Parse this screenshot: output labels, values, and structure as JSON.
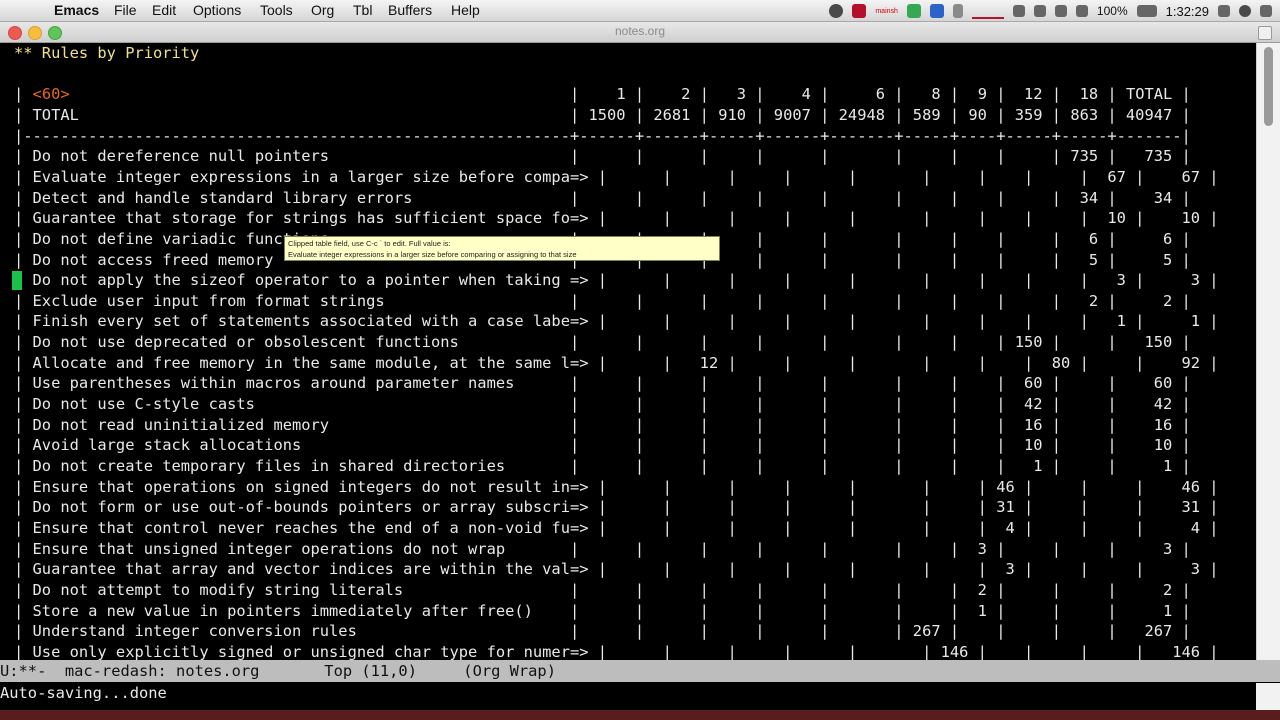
{
  "menubar": {
    "apple": "",
    "app": "Emacs",
    "items": [
      "File",
      "Edit",
      "Options",
      "Tools",
      "Org",
      "Tbl",
      "Buffers",
      "Help"
    ],
    "status": {
      "user_label": "mainsh",
      "battery": "100%",
      "clock": "1:32:29"
    }
  },
  "window": {
    "title": "notes.org"
  },
  "buffer": {
    "lines": [
      {
        "cls": "heading",
        "text": "** Rules by Priority"
      },
      {
        "cls": "blank",
        "text": ""
      },
      {
        "cls": "cookie",
        "pre": "| ",
        "hl": "<60>",
        "post": "                                                      |    1 |    2 |   3 |    4 |     6 |   8 |  9 |  12 |  18 | TOTAL |"
      },
      {
        "cls": "tbl",
        "text": "| TOTAL                                                     | 1500 | 2681 | 910 | 9007 | 24948 | 589 | 90 | 359 | 863 | 40947 |"
      },
      {
        "cls": "sep",
        "text": "|-----------------------------------------------------------+------+------+-----+------+-------+-----+----+-----+-----+-------|"
      },
      {
        "cls": "tbl",
        "text": "| Do not dereference null pointers                          |      |      |     |      |       |     |    |     | 735 |   735 |"
      },
      {
        "cls": "tbl",
        "text": "| Evaluate integer expressions in a larger size before compa=> |      |      |     |      |       |     |    |     |  67 |    67 |"
      },
      {
        "cls": "tbl",
        "text": "| Detect and handle standard library errors                 |      |      |     |      |       |     |    |     |  34 |    34 |"
      },
      {
        "cls": "tbl",
        "text": "| Guarantee that storage for strings has sufficient space fo=> |      |      |     |      |       |     |    |     |  10 |    10 |"
      },
      {
        "cls": "tbl",
        "text": "| Do not define variadic functions                          |      |      |     |      |       |     |    |     |   6 |     6 |"
      },
      {
        "cls": "tbl",
        "text": "| Do not access freed memory                                |      |      |     |      |       |     |    |     |   5 |     5 |"
      },
      {
        "cls": "tbl",
        "text": "| Do not apply the sizeof operator to a pointer when taking => |      |      |     |      |       |     |    |     |   3 |     3 |"
      },
      {
        "cls": "tbl",
        "text": "| Exclude user input from format strings                    |      |      |     |      |       |     |    |     |   2 |     2 |"
      },
      {
        "cls": "tbl",
        "text": "| Finish every set of statements associated with a case labe=> |      |      |     |      |       |     |    |     |   1 |     1 |"
      },
      {
        "cls": "tbl",
        "text": "| Do not use deprecated or obsolescent functions            |      |      |     |      |       |     |    | 150 |     |   150 |"
      },
      {
        "cls": "tbl",
        "text": "| Allocate and free memory in the same module, at the same l=> |      |   12 |     |      |       |     |    |  80 |     |    92 |"
      },
      {
        "cls": "tbl",
        "text": "| Use parentheses within macros around parameter names      |      |      |     |      |       |     |    |  60 |     |    60 |"
      },
      {
        "cls": "tbl",
        "text": "| Do not use C-style casts                                  |      |      |     |      |       |     |    |  42 |     |    42 |"
      },
      {
        "cls": "tbl",
        "text": "| Do not read uninitialized memory                          |      |      |     |      |       |     |    |  16 |     |    16 |"
      },
      {
        "cls": "tbl",
        "text": "| Avoid large stack allocations                             |      |      |     |      |       |     |    |  10 |     |    10 |"
      },
      {
        "cls": "tbl",
        "text": "| Do not create temporary files in shared directories       |      |      |     |      |       |     |    |   1 |     |     1 |"
      },
      {
        "cls": "tbl",
        "text": "| Ensure that operations on signed integers do not result in=> |      |      |     |      |       |     | 46 |     |     |    46 |"
      },
      {
        "cls": "tbl",
        "text": "| Do not form or use out-of-bounds pointers or array subscri=> |      |      |     |      |       |     | 31 |     |     |    31 |"
      },
      {
        "cls": "tbl",
        "text": "| Ensure that control never reaches the end of a non-void fu=> |      |      |     |      |       |     |  4 |     |     |     4 |"
      },
      {
        "cls": "tbl",
        "text": "| Ensure that unsigned integer operations do not wrap       |      |      |     |      |       |     |  3 |     |     |     3 |"
      },
      {
        "cls": "tbl",
        "text": "| Guarantee that array and vector indices are within the val=> |      |      |     |      |       |     |  3 |     |     |     3 |"
      },
      {
        "cls": "tbl",
        "text": "| Do not attempt to modify string literals                  |      |      |     |      |       |     |  2 |     |     |     2 |"
      },
      {
        "cls": "tbl",
        "text": "| Store a new value in pointers immediately after free()    |      |      |     |      |       |     |  1 |     |     |     1 |"
      },
      {
        "cls": "tbl",
        "text": "| Understand integer conversion rules                       |      |      |     |      |       | 267 |    |     |     |   267 |"
      },
      {
        "cls": "tbl",
        "text": "| Use only explicitly signed or unsigned char type for numer=> |      |      |     |      |       | 146 |    |     |     |   146 |"
      }
    ]
  },
  "tooltip": {
    "line1": "Clipped table field, use C-c ` to edit.  Full value is:",
    "line2": "Evaluate integer expressions in a larger size before comparing or assigning to that size"
  },
  "modeline": {
    "text": "U:**-  mac-redash: notes.org       Top (11,0)     (Org Wrap)"
  },
  "echo": {
    "text": "Auto-saving...done"
  }
}
